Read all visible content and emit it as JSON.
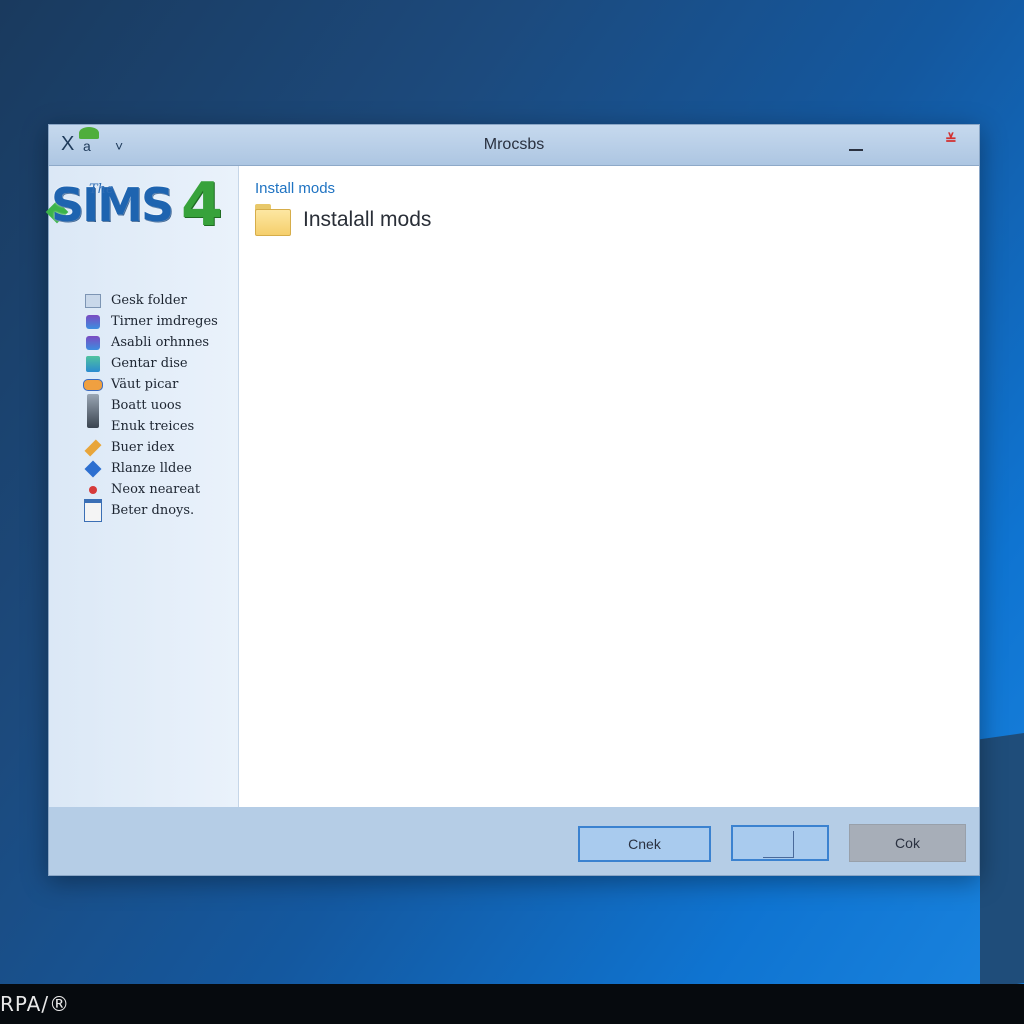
{
  "window": {
    "title": "Mrocsbs",
    "minimize_icon": "minimize-icon",
    "close_icon": "close-icon"
  },
  "toolbar": {
    "x_glyph": "X",
    "a_glyph": "a",
    "chevron_glyph": "˅"
  },
  "logo": {
    "the": "The",
    "sims": "SIMS",
    "four": "4"
  },
  "sidebar": {
    "items": [
      {
        "label": "Gesk folder",
        "icon": "page-icon"
      },
      {
        "label": "Tirner imdreges",
        "icon": "tools-icon"
      },
      {
        "label": "Asabli orhnnes",
        "icon": "tools-icon"
      },
      {
        "label": "Gentar dise",
        "icon": "bucket-icon"
      },
      {
        "label": "Väut picar",
        "icon": "vial-icon"
      },
      {
        "label": "Boatt uoos",
        "icon": "phone-icon"
      },
      {
        "label": "Enuk treices",
        "icon": "phone-icon"
      },
      {
        "label": "Buer idex",
        "icon": "pen-icon"
      },
      {
        "label": "Rlanze lldee",
        "icon": "gem-icon"
      },
      {
        "label": "Neox neareat",
        "icon": "dot-icon"
      },
      {
        "label": "Beter dnoys.",
        "icon": "calendar-icon"
      }
    ]
  },
  "content": {
    "breadcrumb": "Install mods",
    "folder_label": "Instalall mods"
  },
  "footer": {
    "button_a": "Cnek",
    "button_b": "",
    "button_c": "Cok"
  },
  "taskbar": {
    "text": "RPA/®"
  },
  "colors": {
    "accent": "#1f73c2",
    "button_border": "#3b82d0",
    "dialog_frame": "#b5cde6"
  }
}
